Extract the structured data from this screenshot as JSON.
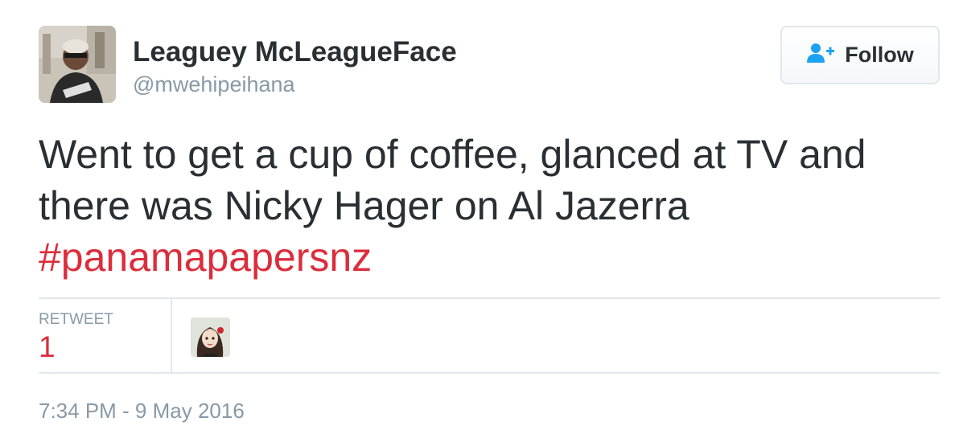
{
  "author": {
    "name": "Leaguey McLeagueFace",
    "handle": "@mwehipeihana"
  },
  "follow_button": {
    "label": "Follow",
    "icon": "add-user-icon"
  },
  "tweet": {
    "text_line1": "Went to get a cup of coffee, glanced at TV and",
    "text_line2": "there was Nicky Hager on Al Jazerra",
    "hashtag": "#panamapapersnz"
  },
  "stats": {
    "retweet_label": "RETWEET",
    "retweet_count": "1"
  },
  "timestamp": "7:34 PM - 9 May 2016",
  "colors": {
    "text": "#292f33",
    "muted": "#8899a6",
    "accent_red": "#dc2d3c",
    "link_blue": "#1da1f2",
    "border": "#e1e8ed"
  }
}
